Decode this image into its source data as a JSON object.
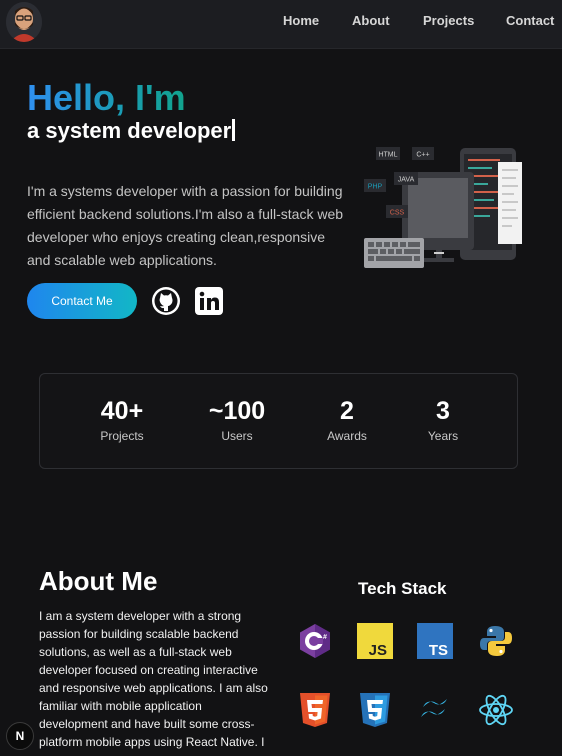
{
  "nav": {
    "links": [
      "Home",
      "About",
      "Projects",
      "Contact"
    ]
  },
  "hero": {
    "greeting": "Hello, I'm",
    "role": "a system developer",
    "intro": "I'm a systems developer with a passion for building efficient backend solutions.I'm also a full-stack web developer who enjoys creating clean,responsive and scalable web applications.",
    "contact_label": "Contact Me",
    "illustration_labels": [
      "HTML",
      "C++",
      "PHP",
      "JAVA",
      "CSS"
    ]
  },
  "stats": [
    {
      "value": "40+",
      "label": "Projects"
    },
    {
      "value": "~100",
      "label": "Users"
    },
    {
      "value": "2",
      "label": "Awards"
    },
    {
      "value": "3",
      "label": "Years"
    }
  ],
  "about": {
    "title": "About Me",
    "text": "I am a system developer with a strong passion for building scalable backend solutions, as well as a full-stack web developer focused on creating interactive and responsive web applications. I am also familiar with mobile application development and have built some cross-platform mobile apps using React Native. I"
  },
  "tech": {
    "title": "Tech Stack",
    "items": [
      {
        "icon": "csharp-icon",
        "text": "C#",
        "color": "#7b3fa0"
      },
      {
        "icon": "javascript-icon",
        "text": "JS",
        "color": "#f0d93c"
      },
      {
        "icon": "typescript-icon",
        "text": "TS",
        "color": "#2f74c0"
      },
      {
        "icon": "python-icon",
        "color": "#3b77a8"
      },
      {
        "icon": "html5-icon",
        "text": "5",
        "color": "#e4502a"
      },
      {
        "icon": "css3-icon",
        "text": "3",
        "color": "#2572b8"
      },
      {
        "icon": "tailwind-icon",
        "color": "#36b6e5"
      },
      {
        "icon": "react-icon",
        "color": "#5fd6f5"
      }
    ]
  },
  "badge": "N"
}
